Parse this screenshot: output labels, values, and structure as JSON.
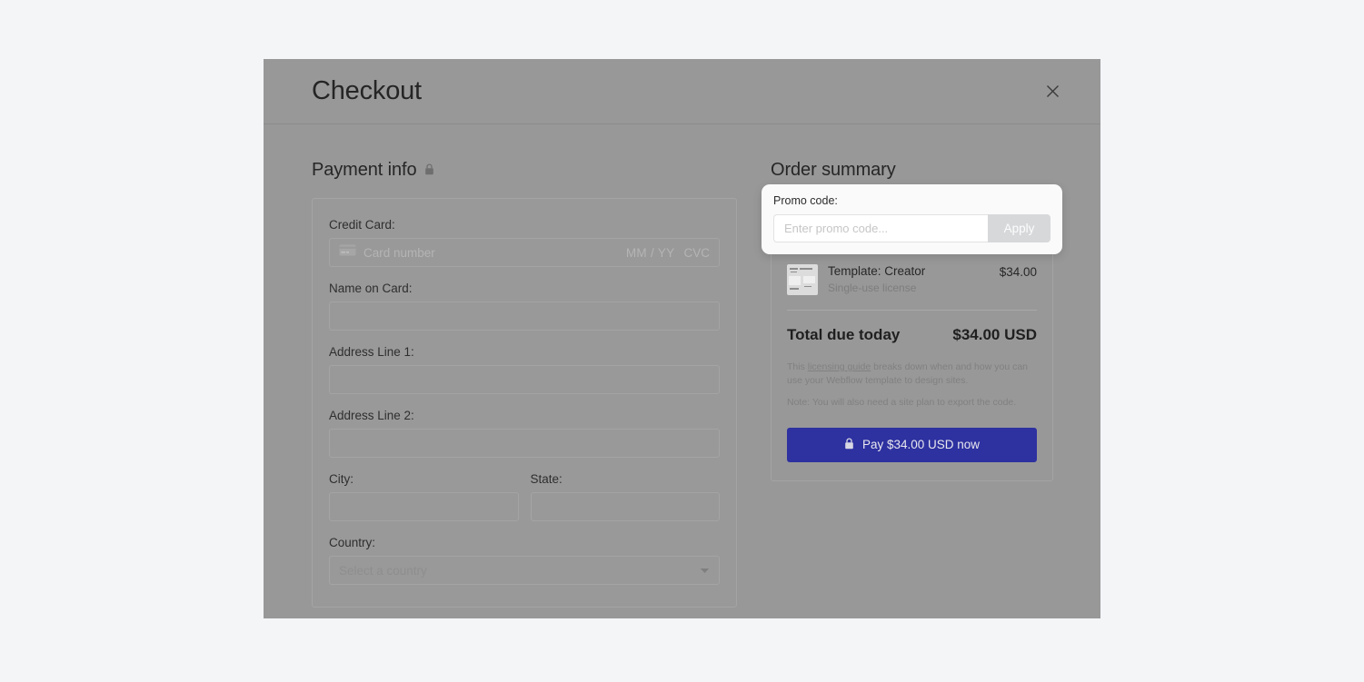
{
  "modal": {
    "title": "Checkout",
    "close_icon": "close-icon"
  },
  "payment": {
    "section_title": "Payment info",
    "lock_icon": "lock-icon",
    "fields": {
      "credit_card_label": "Credit Card:",
      "card_number_placeholder": "Card number",
      "card_icon": "credit-card-icon",
      "expiry_placeholder": "MM / YY",
      "cvc_placeholder": "CVC",
      "name_label": "Name on Card:",
      "name_value": "",
      "address1_label": "Address Line 1:",
      "address1_value": "",
      "address2_label": "Address Line 2:",
      "address2_value": "",
      "city_label": "City:",
      "city_value": "",
      "state_label": "State:",
      "state_value": "",
      "country_label": "Country:",
      "country_value": "Select a country"
    }
  },
  "order_summary": {
    "section_title": "Order summary",
    "items": [
      {
        "name": "Template: Creator",
        "sublabel": "Single-use license",
        "price": "$34.00",
        "thumb_icon": "template-thumbnail"
      }
    ],
    "total_label": "Total due today",
    "total_value": "$34.00 USD",
    "fine_print_1_before": "This ",
    "fine_print_1_link": "licensing guide",
    "fine_print_1_after": " breaks down when and how you can use your Webflow template to design sites.",
    "fine_print_2": "Note: You will also need a site plan to export the code.",
    "pay_button_label": "Pay $34.00 USD now",
    "pay_button_icon": "lock-icon",
    "pay_button_color": "#2e31a0"
  },
  "promo": {
    "label": "Promo code:",
    "input_value": "",
    "input_placeholder": "Enter promo code...",
    "apply_label": "Apply"
  }
}
